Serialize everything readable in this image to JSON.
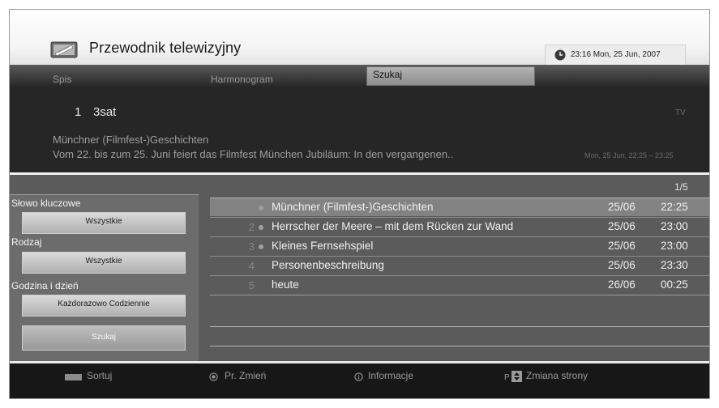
{
  "header": {
    "title": "Przewodnik telewizyjny",
    "clock": "23:16 Mon, 25 Jun, 2007"
  },
  "tabs": [
    {
      "label": "Spis",
      "active": false
    },
    {
      "label": "Harmonogram",
      "active": false
    },
    {
      "label": "Szukaj",
      "active": true
    }
  ],
  "info": {
    "channel_number": "1",
    "channel_name": "3sat",
    "channel_type": "TV",
    "program_title": "Münchner (Filmfest-)Geschichten",
    "program_description": "Vom 22. bis zum 25. Juni feiert das Filmfest München Jubiläum: In den vergangenen..",
    "program_time": "Mon, 25 Jun, 22:25 – 23:25"
  },
  "page_indicator": "1/5",
  "filters": {
    "keyword_label": "Słowo kluczowe",
    "keyword_value": "Wszystkie",
    "genre_label": "Rodzaj",
    "genre_value": "Wszystkie",
    "time_label": "Godzina i dzień",
    "time_value": "Każdorazowo  Codziennie",
    "search_button": "Szukaj"
  },
  "results": [
    {
      "num": "1",
      "title": "Münchner (Filmfest-)Geschichten",
      "date": "25/06",
      "time": "22:25"
    },
    {
      "num": "2",
      "title": "Herrscher der Meere – mit dem Rücken zur Wand",
      "date": "25/06",
      "time": "23:00"
    },
    {
      "num": "3",
      "title": "Kleines Fernsehspiel",
      "date": "25/06",
      "time": "23:00"
    },
    {
      "num": "4",
      "title": "Personenbeschreibung",
      "date": "25/06",
      "time": "23:30"
    },
    {
      "num": "5",
      "title": "heute",
      "date": "26/06",
      "time": "00:25"
    }
  ],
  "footer": {
    "sort": "Sortuj",
    "ok": "Pr. Zmień",
    "info": "Informacje",
    "page_change": "Zmiana strony",
    "page_key_label": "P"
  },
  "colors": {
    "sort_button": "#8c8c8c",
    "selected_row": "#828282"
  }
}
